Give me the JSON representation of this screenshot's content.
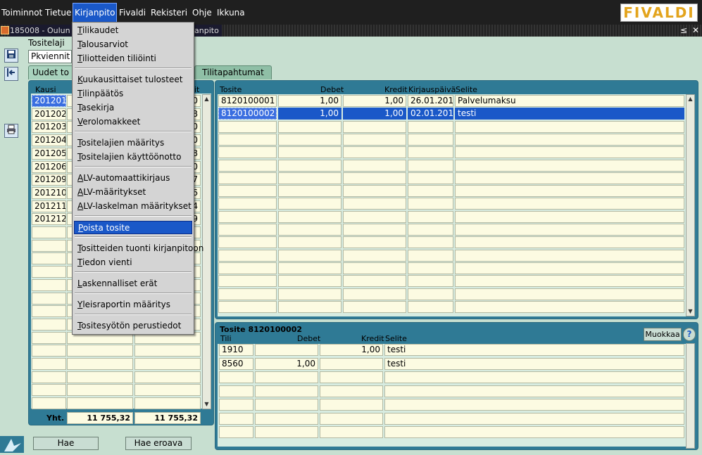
{
  "menubar": {
    "items": [
      "Toiminnot",
      "Tietue",
      "Kirjanpito",
      "Fivaldi",
      "Rekisteri",
      "Ohje",
      "Ikkuna"
    ],
    "logo": "FIVALDI"
  },
  "titlebar": {
    "title_start": "185008 - Oulun",
    "title_end": "anpito",
    "controls": [
      "≤",
      "✕"
    ]
  },
  "form": {
    "tositelaji_label": "Tositelaji",
    "tositelaji_value": "Pkviennit"
  },
  "tabs": [
    "Uudet to",
    "Tilitapahtumat"
  ],
  "left_panel": {
    "col_kausi": "Kausi",
    "col_end": "it",
    "rows": [
      {
        "kausi": "201201",
        "end": "0"
      },
      {
        "kausi": "201202",
        "end": "8"
      },
      {
        "kausi": "201203",
        "end": "0"
      },
      {
        "kausi": "201204",
        "end": "0"
      },
      {
        "kausi": "201205",
        "end": "8"
      },
      {
        "kausi": "201206",
        "end": "0"
      },
      {
        "kausi": "201209",
        "end": "7"
      },
      {
        "kausi": "201210",
        "end": "6"
      },
      {
        "kausi": "201211",
        "end": "4"
      },
      {
        "kausi": "201212",
        "end": "9"
      }
    ],
    "total_label": "Yht.",
    "total_1": "11 755,32",
    "total_2": "11 755,32"
  },
  "buttons": {
    "hae": "Hae",
    "hae_eroava": "Hae eroava",
    "muokkaa": "Muokkaa",
    "help": "?"
  },
  "tosite_list": {
    "headers": {
      "tosite": "Tosite",
      "debet": "Debet",
      "kredit": "Kredit",
      "kirjauspaiva": "Kirjauspäivä",
      "selite": "Selite"
    },
    "rows": [
      {
        "tosite": "8120100001",
        "debet": "1,00",
        "kredit": "1,00",
        "paiva": "26.01.2012",
        "selite": "Palvelumaksu"
      },
      {
        "tosite": "8120100002",
        "debet": "1,00",
        "kredit": "1,00",
        "paiva": "02.01.2012",
        "selite": "testi"
      }
    ]
  },
  "tosite_detail": {
    "title": "Tosite 8120100002",
    "headers": {
      "tili": "Tili",
      "debet": "Debet",
      "kredit": "Kredit",
      "selite": "Selite"
    },
    "rows": [
      {
        "tili": "1910",
        "debet": "",
        "kredit": "1,00",
        "selite": "testi"
      },
      {
        "tili": "8560",
        "debet": "1,00",
        "kredit": "",
        "selite": "testi"
      }
    ]
  },
  "dropdown": {
    "items": [
      {
        "u": "T",
        "rest": "ilikaudet"
      },
      {
        "u": "T",
        "rest": "alousarviot"
      },
      {
        "u": "T",
        "rest": "iliotteiden tiliöinti"
      },
      {
        "u": "K",
        "rest": "uukausittaiset tulosteet"
      },
      {
        "u": "T",
        "rest": "ilinpäätös"
      },
      {
        "u": "T",
        "rest": "asekirja"
      },
      {
        "u": "V",
        "rest": "erolomakkeet"
      },
      {
        "u": "T",
        "rest": "ositelajien määritys"
      },
      {
        "u": "T",
        "rest": "ositelajien käyttöönotto"
      },
      {
        "u": "A",
        "rest": "LV-automaattikirjaus"
      },
      {
        "u": "A",
        "rest": "LV-määritykset"
      },
      {
        "u": "A",
        "rest": "LV-laskelman määritykset"
      },
      {
        "u": "P",
        "rest": "oista tosite"
      },
      {
        "u": "T",
        "rest": "ositteiden tuonti kirjanpitoon"
      },
      {
        "u": "T",
        "rest": "iedon vienti"
      },
      {
        "u": "L",
        "rest": "askennalliset erät"
      },
      {
        "u": "Y",
        "rest": "leisraportin määritys"
      },
      {
        "u": "T",
        "rest": "ositesyötön perustiedot"
      }
    ]
  }
}
